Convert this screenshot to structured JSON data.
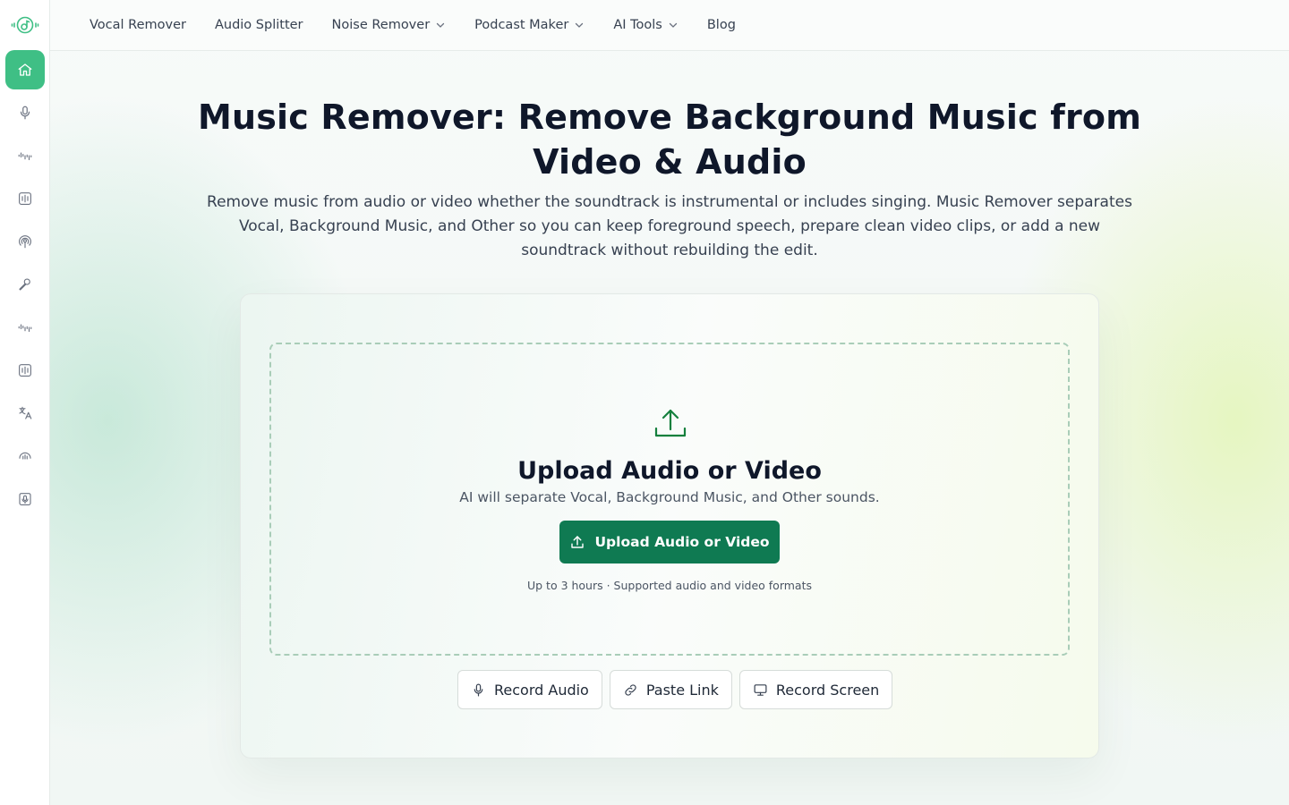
{
  "nav": {
    "items": [
      {
        "label": "Vocal Remover",
        "dropdown": false
      },
      {
        "label": "Audio Splitter",
        "dropdown": false
      },
      {
        "label": "Noise Remover",
        "dropdown": true
      },
      {
        "label": "Podcast Maker",
        "dropdown": true
      },
      {
        "label": "AI Tools",
        "dropdown": true
      },
      {
        "label": "Blog",
        "dropdown": false
      }
    ]
  },
  "sidebar": {
    "active_index": 0,
    "items": [
      {
        "icon": "home-icon"
      },
      {
        "icon": "microphone-icon"
      },
      {
        "icon": "waveform-icon"
      },
      {
        "icon": "audio-bars-icon"
      },
      {
        "icon": "podcast-icon"
      },
      {
        "icon": "singer-icon"
      },
      {
        "icon": "waveform-icon"
      },
      {
        "icon": "audio-bars-icon"
      },
      {
        "icon": "translate-icon"
      },
      {
        "icon": "audio-speed-icon"
      },
      {
        "icon": "recorder-icon"
      }
    ]
  },
  "hero": {
    "title": "Music Remover: Remove Background Music from Video & Audio",
    "subtitle": "Remove music from audio or video whether the soundtrack is instrumental or includes singing. Music Remover separates Vocal, Background Music, and Other so you can keep foreground speech, prepare clean video clips, or add a new soundtrack without rebuilding the edit."
  },
  "upload": {
    "title": "Upload Audio or Video",
    "subtitle": "AI will separate Vocal, Background Music, and Other sounds.",
    "button_label": "Upload Audio or Video",
    "note": "Up to 3 hours · Supported audio and video formats"
  },
  "alt_actions": [
    {
      "label": "Record Audio",
      "icon": "microphone-icon"
    },
    {
      "label": "Paste Link",
      "icon": "link-icon"
    },
    {
      "label": "Record Screen",
      "icon": "monitor-icon"
    }
  ],
  "colors": {
    "accent": "#3fbf85",
    "primary_button": "#0f7a52",
    "upload_icon": "#15803d"
  }
}
